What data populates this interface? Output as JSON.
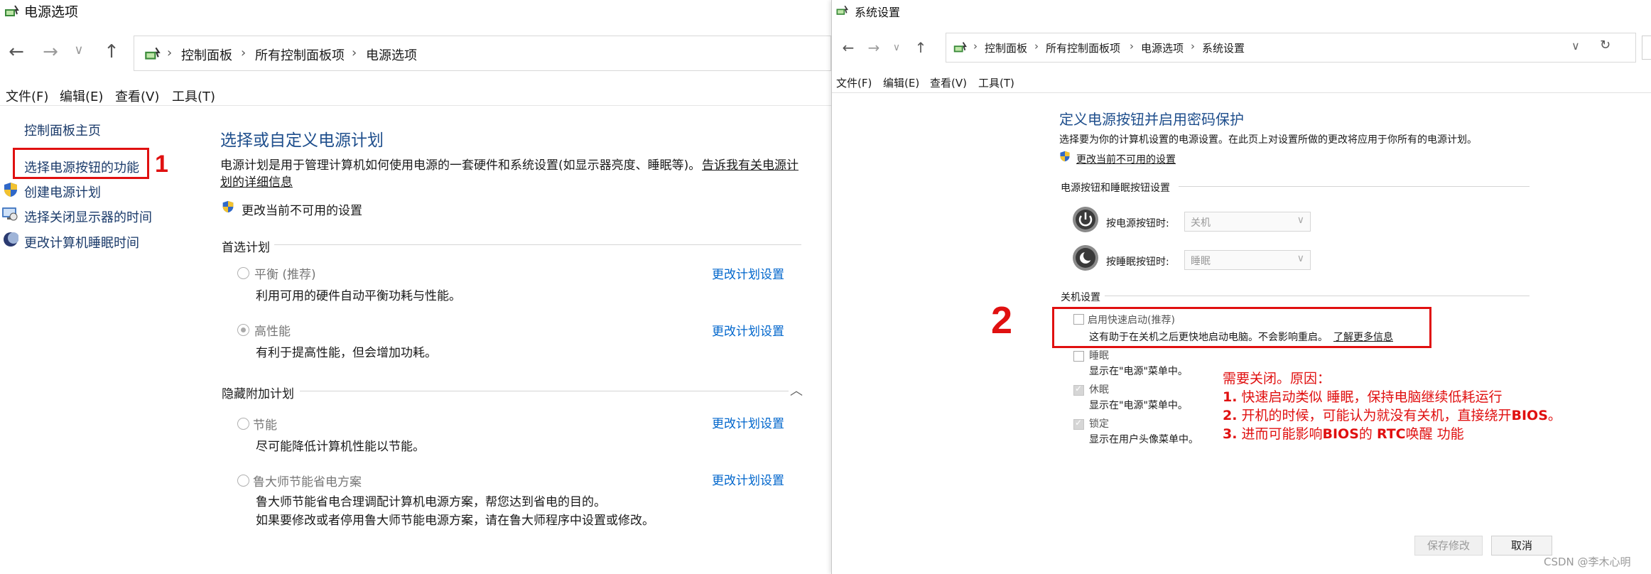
{
  "left_window": {
    "title": "电源选项",
    "breadcrumb": [
      "控制面板",
      "所有控制面板项",
      "电源选项"
    ],
    "menu": [
      "文件(F)",
      "编辑(E)",
      "查看(V)",
      "工具(T)"
    ],
    "sidebar": {
      "home": "控制面板主页",
      "items": [
        "选择电源按钮的功能",
        "创建电源计划",
        "选择关闭显示器的时间",
        "更改计算机睡眠时间"
      ]
    },
    "main": {
      "heading": "选择或自定义电源计划",
      "intro_line1": "电源计划是用于管理计算机如何使用电源的一套硬件和系统设置(如显示器亮度、睡眠等)。",
      "intro_link_part1": "告诉我有关电源计",
      "intro_link_part2": "划的详细信息",
      "change_unavailable": "更改当前不可用的设置",
      "preferred_title": "首选计划",
      "hidden_title": "隐藏附加计划",
      "plans": [
        {
          "name": "平衡 (推荐)",
          "desc": "利用可用的硬件自动平衡功耗与性能。",
          "link": "更改计划设置",
          "selected": false
        },
        {
          "name": "高性能",
          "desc": "有利于提高性能，但会增加功耗。",
          "link": "更改计划设置",
          "selected": true
        }
      ],
      "hidden_plans": [
        {
          "name": "节能",
          "desc": "尽可能降低计算机性能以节能。",
          "link": "更改计划设置"
        },
        {
          "name": "鲁大师节能省电方案",
          "desc": "鲁大师节能省电合理调配计算机电源方案，帮您达到省电的目的。",
          "desc2": "如果要修改或者停用鲁大师节能电源方案，请在鲁大师程序中设置或修改。",
          "link": "更改计划设置"
        }
      ]
    },
    "annotation_number": "1"
  },
  "right_window": {
    "title": "系统设置",
    "breadcrumb": [
      "控制面板",
      "所有控制面板项",
      "电源选项",
      "系统设置"
    ],
    "menu": [
      "文件(F)",
      "编辑(E)",
      "查看(V)",
      "工具(T)"
    ],
    "heading": "定义电源按钮并启用密码保护",
    "intro": "选择要为你的计算机设置的电源设置。在此页上对设置所做的更改将应用于你所有的电源计划。",
    "change_unavailable": "更改当前不可用的设置",
    "power_section_title": "电源按钮和睡眠按钮设置",
    "power_button_label": "按电源按钮时:",
    "power_button_value": "关机",
    "sleep_button_label": "按睡眠按钮时:",
    "sleep_button_value": "睡眠",
    "shutdown_section_title": "关机设置",
    "shutdown_items": [
      {
        "label": "启用快速启动(推荐)",
        "desc": "这有助于在关机之后更快地启动电脑。不会影响重启。",
        "link": "了解更多信息",
        "checked": false
      },
      {
        "label": "睡眠",
        "desc": "显示在\"电源\"菜单中。",
        "checked": false
      },
      {
        "label": "休眠",
        "desc": "显示在\"电源\"菜单中。",
        "checked": true
      },
      {
        "label": "锁定",
        "desc": "显示在用户头像菜单中。",
        "checked": true
      }
    ],
    "annotation_number": "2",
    "annotation": {
      "line1": "需要关闭。原因：",
      "line2_num": "1.",
      "line2": " 快速启动类似 睡眠，保持电脑继续低耗运行",
      "line3_num": "2.",
      "line3_a": " 开机的时候，可能认为就没有关机，直接绕开",
      "line3_b": "BIOS",
      "line3_c": "。",
      "line4_num": "3.",
      "line4_a": " 进而可能影响",
      "line4_b": "BIOS",
      "line4_c": "的 ",
      "line4_d": "RTC",
      "line4_e": "唤醒 功能"
    },
    "save_button": "保存修改",
    "cancel_button": "取消",
    "watermark": "CSDN @李木心明"
  },
  "colors": {
    "accent": "#0066cc",
    "heading": "#1e4e8c",
    "annotation": "#e01010"
  }
}
